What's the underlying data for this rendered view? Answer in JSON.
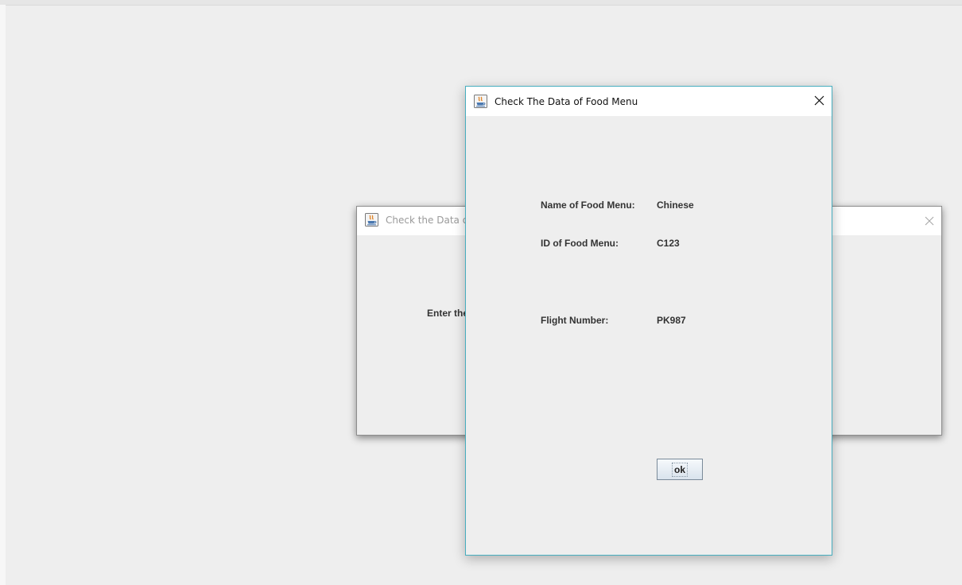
{
  "background_dialog": {
    "title": "Check the Data of Food Menu",
    "prompt": "Enter the",
    "close_glyph": "×",
    "icon": "java-app-icon"
  },
  "dialog": {
    "title": "Check The Data of Food Menu",
    "close_glyph": "×",
    "icon": "java-app-icon",
    "fields": {
      "name": {
        "label": "Name of Food Menu:",
        "value": "Chinese"
      },
      "id": {
        "label": "ID of Food Menu:",
        "value": "C123"
      },
      "flight": {
        "label": "Flight Number:",
        "value": "PK987"
      }
    },
    "ok_label": "ok"
  },
  "colors": {
    "window_bg": "#eeeeee",
    "active_border": "#47aebf",
    "inactive_border": "#8d8d8d",
    "label_text": "#333333"
  }
}
